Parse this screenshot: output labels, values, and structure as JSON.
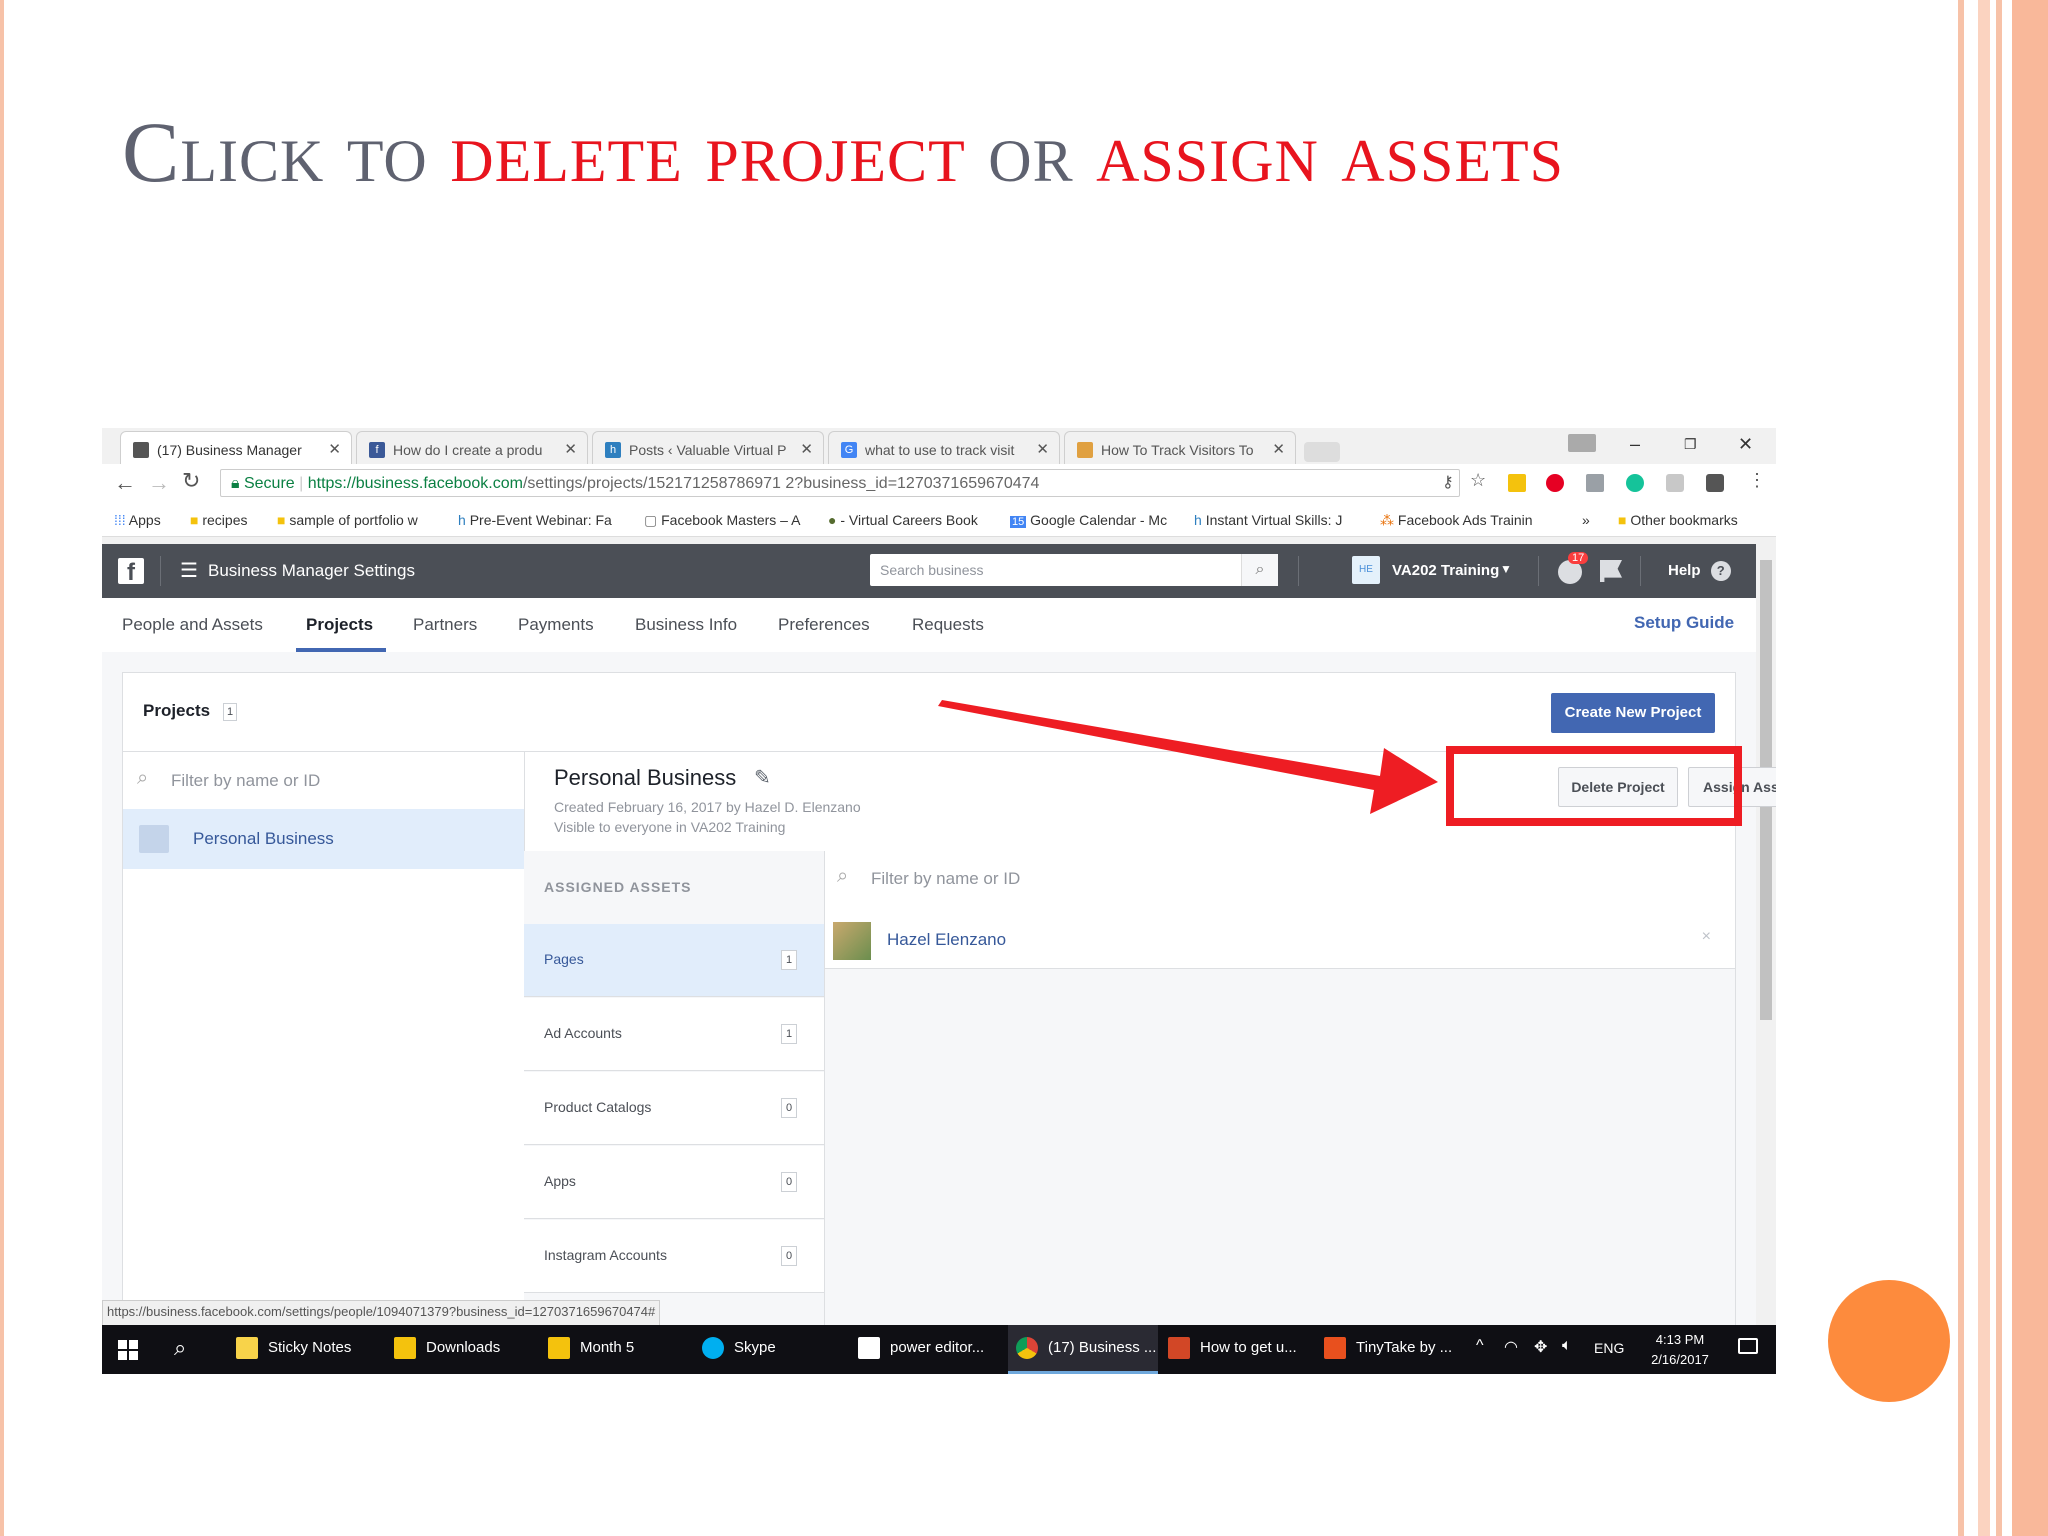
{
  "slide": {
    "title_parts": [
      {
        "text": "Click to ",
        "red": false
      },
      {
        "text": "delete project",
        "red": true
      },
      {
        "text": " or ",
        "red": false
      },
      {
        "text": "assign assets",
        "red": true
      }
    ],
    "colors": {
      "accent_red": "#e8141e",
      "title_gray": "#5f6270",
      "orange_circle": "#fd8b3d",
      "side_bars": "#f7c2a8"
    }
  },
  "browser": {
    "tabs": [
      {
        "label": "(17) Business Manager",
        "icon": "page-icon"
      },
      {
        "label": "How do I create a produ",
        "icon": "facebook-icon"
      },
      {
        "label": "Posts ‹ Valuable Virtual P",
        "icon": "h-logo-icon"
      },
      {
        "label": "what to use to track visit",
        "icon": "google-icon"
      },
      {
        "label": "How To Track Visitors To",
        "icon": "site-icon"
      }
    ],
    "secure_label": "Secure",
    "url_host": "https://business.facebook.com",
    "url_path": "/settings/projects/152171258786971 2?business_id=1270371659670474",
    "bookmarks": [
      "Apps",
      "recipes",
      "sample of portfolio w",
      "Pre-Event Webinar: Fa",
      "Facebook Masters – A",
      "- Virtual Careers Book",
      "Google Calendar - Mc",
      "Instant Virtual Skills: J",
      "Facebook Ads Trainin"
    ],
    "bookmarks_more": "»",
    "other_bookmarks": "Other bookmarks",
    "status_url": "https://business.facebook.com/settings/people/1094071379?business_id=1270371659670474#"
  },
  "fb": {
    "app_title": "Business Manager Settings",
    "search_placeholder": "Search business",
    "business_initials": "HE",
    "business_name": "VA202 Training",
    "notification_count": "17",
    "help_label": "Help",
    "nav_tabs": [
      "People and Assets",
      "Projects",
      "Partners",
      "Payments",
      "Business Info",
      "Preferences",
      "Requests"
    ],
    "setup_guide": "Setup Guide",
    "projects_label": "Projects",
    "projects_count": "1",
    "create_button": "Create New Project",
    "filter_placeholder": "Filter by name or ID",
    "project_list": [
      "Personal Business"
    ],
    "project": {
      "name": "Personal Business",
      "created": "Created February 16, 2017 by Hazel D. Elenzano",
      "visibility": "Visible to everyone in VA202 Training"
    },
    "delete_button": "Delete Project",
    "assign_button": "Assign Assets",
    "assigned_assets_header": "ASSIGNED ASSETS",
    "asset_categories": [
      {
        "label": "Pages",
        "count": "1"
      },
      {
        "label": "Ad Accounts",
        "count": "1"
      },
      {
        "label": "Product Catalogs",
        "count": "0"
      },
      {
        "label": "Apps",
        "count": "0"
      },
      {
        "label": "Instagram Accounts",
        "count": "0"
      }
    ],
    "asset_filter_placeholder": "Filter by name or ID",
    "assets": [
      "Hazel Elenzano"
    ],
    "remove_icon": "×"
  },
  "taskbar": {
    "items": [
      "Sticky Notes",
      "Downloads",
      "Month 5",
      "Skype",
      "power editor...",
      "(17) Business ...",
      "How to get u...",
      "TinyTake by ..."
    ],
    "language": "ENG",
    "time": "4:13 PM",
    "date": "2/16/2017"
  }
}
